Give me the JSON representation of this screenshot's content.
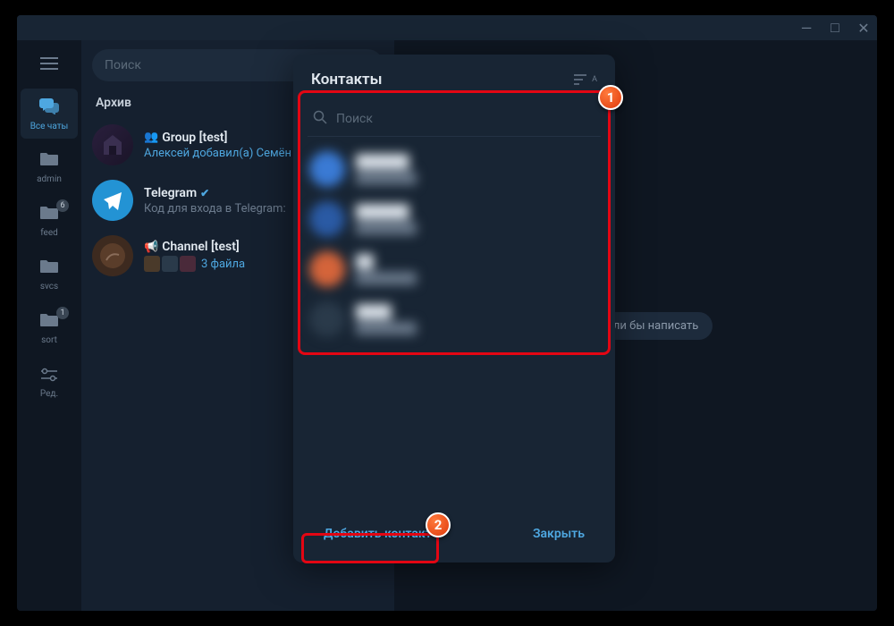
{
  "titlebar": {
    "min": "—",
    "max": "□",
    "close": "✕"
  },
  "search": {
    "placeholder": "Поиск"
  },
  "nav": {
    "all_chats": "Все чаты",
    "admin": "admin",
    "feed": "feed",
    "feed_badge": "6",
    "svcs": "svcs",
    "sort": "sort",
    "sort_badge": "1",
    "edit": "Ред."
  },
  "archive_label": "Архив",
  "chats": [
    {
      "title": "Group [test]",
      "subtitle": "Алексей добавил(а) Семён"
    },
    {
      "title": "Telegram",
      "subtitle": "Код для входа в Telegram:"
    },
    {
      "title": "Channel [test]",
      "subtitle": "3 файла"
    }
  ],
  "main_hint": "му хотели бы написать",
  "modal": {
    "title": "Контакты",
    "search_placeholder": "Поиск",
    "add_button": "Добавить контакт",
    "close_button": "Закрыть"
  },
  "callouts": {
    "one": "1",
    "two": "2"
  }
}
